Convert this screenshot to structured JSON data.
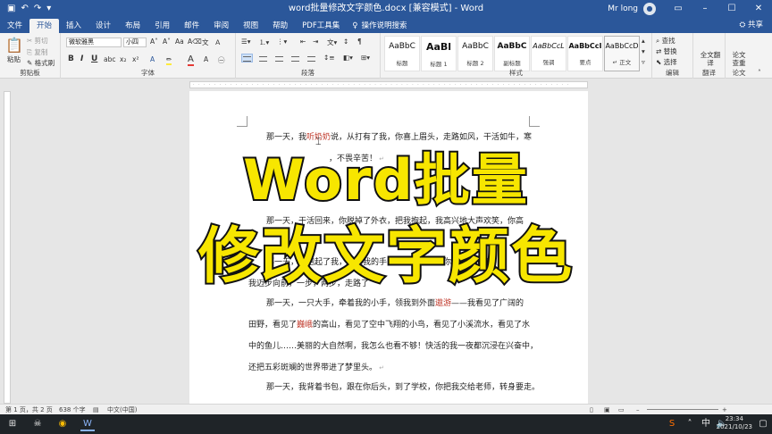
{
  "window": {
    "title": "word批量修改文字颜色.docx [兼容模式] - Word",
    "user": "Mr long",
    "share": "共享"
  },
  "tabs": [
    "文件",
    "开始",
    "插入",
    "设计",
    "布局",
    "引用",
    "邮件",
    "审阅",
    "视图",
    "帮助",
    "PDF工具集"
  ],
  "active_tab": "开始",
  "tell_me": "操作说明搜索",
  "ribbon": {
    "clipboard": {
      "label": "剪贴板",
      "paste": "粘贴",
      "cut": "剪切",
      "copy": "复制",
      "format_painter": "格式刷"
    },
    "font": {
      "label": "字体",
      "family": "微软雅黑",
      "size": "小四"
    },
    "paragraph": {
      "label": "段落"
    },
    "styles": {
      "label": "样式",
      "items": [
        {
          "sample": "AaBbC",
          "name": "标题"
        },
        {
          "sample": "AaBl",
          "name": "标题 1"
        },
        {
          "sample": "AaBbC",
          "name": "标题 2"
        },
        {
          "sample": "AaBbC",
          "name": "副标题"
        },
        {
          "sample": "AaBbCcL",
          "name": "强调"
        },
        {
          "sample": "AaBbCcI",
          "name": "要点"
        },
        {
          "sample": "AaBbCcD",
          "name": "↵ 正文"
        }
      ]
    },
    "editing": {
      "label": "编辑",
      "find": "查找",
      "replace": "替换",
      "select": "选择"
    },
    "translate": {
      "label": "翻译",
      "full": "全文翻译"
    },
    "compare": {
      "label": "论文",
      "full": "论文查重"
    }
  },
  "document": {
    "paragraphs": [
      {
        "pre": "那一天，我",
        "hl": "听奶奶",
        "post": "说，从打有了我，你喜上眉头，走路如风，干活如牛，寒"
      },
      {
        "pre": "",
        "hl": "",
        "post": "，不畏辛苦！"
      },
      {
        "pre": "那一天，干活回来，你脱掉了外衣，把我抱起，我高兴地大声欢笑，你高",
        "hl": "",
        "post": ""
      },
      {
        "pre": "那一天，你抱起了我，牵着我的手，教我",
        "hl": "学走路",
        "post": "，你在身后微笑"
      },
      {
        "pre": "",
        "hl": "",
        "post": "我迈步向前，一步，两步，走路了"
      },
      {
        "pre": "那一天，一只大手，牵着我的小手，领我到外面",
        "hl": "遨游",
        "post": "——我看见了广阔的"
      },
      {
        "pre": "田野，看见了",
        "hl": "巍峨",
        "post": "的高山，看见了空中飞翔的小鸟，看见了小溪流水，看见了水"
      },
      {
        "pre": "中的鱼儿……美丽的大自然啊，我怎么也看不够！快活的我一夜都沉浸在兴奋中，",
        "hl": "",
        "post": ""
      },
      {
        "pre": "还把五彩斑斓的世界带进了梦里头。",
        "hl": "",
        "post": ""
      },
      {
        "pre": "那一天，我背着书包，跟在你后头，到了学校，你把我交给老师，转身要走。",
        "hl": "",
        "post": ""
      }
    ]
  },
  "overlay": {
    "line1": "Word批量",
    "line2": "修改文字颜色"
  },
  "status": {
    "page": "第 1 页，共 2 页",
    "words": "638 个字",
    "lang": "中文(中国)"
  },
  "taskbar": {
    "time": "23:34",
    "date": "2021/10/23",
    "ime": "中"
  },
  "colors": {
    "brand": "#2b579a",
    "highlight": "#c0392b",
    "overlay_fill": "#f7e600"
  }
}
